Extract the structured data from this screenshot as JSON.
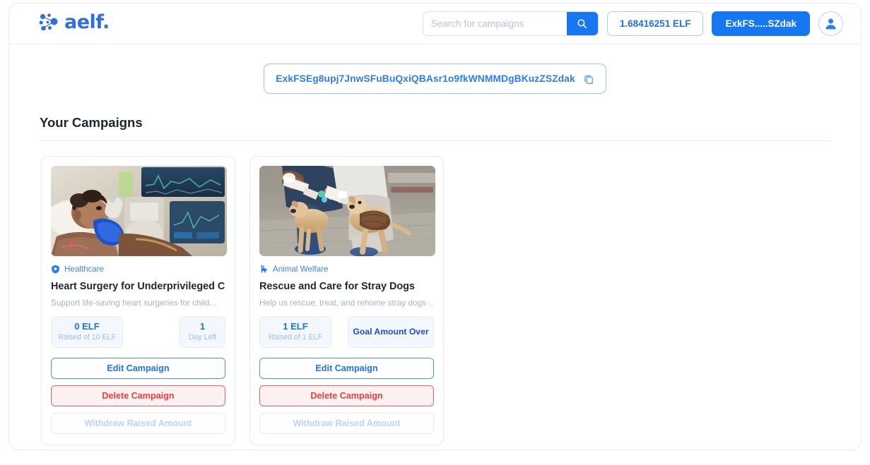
{
  "brand": {
    "name": "aelf.",
    "logo_icon": "aelf-dots-logo"
  },
  "header": {
    "search": {
      "placeholder": "Search for campaigns",
      "value": "",
      "button_icon": "search-icon"
    },
    "balance": "1.68416251 ELF",
    "wallet_button": "ExkFS.....SZdak",
    "avatar_icon": "user-avatar-icon"
  },
  "address_bar": {
    "address": "ExkFSEg8upj7JnwSFuBuQxiQBAsr1o9fkWNMMDgBKuzZSZdak",
    "copy_icon": "copy-icon"
  },
  "main": {
    "section_title": "Your Campaigns"
  },
  "campaigns": [
    {
      "category": "Healthcare",
      "category_icon": "shield-health-icon",
      "title": "Heart Surgery for Underprivileged C...",
      "description": "Support life-saving heart surgeries for child...",
      "raised_amount": "0 ELF",
      "raised_of": "Raised of 10 ELF",
      "meta_primary": "1",
      "meta_secondary": "Day Left",
      "meta_single": "",
      "image_alt": "child-in-hospital-photo",
      "actions": {
        "edit": "Edit Campaign",
        "delete": "Delete Campaign",
        "withdraw": "Withdraw Raised Amount"
      }
    },
    {
      "category": "Animal Welfare",
      "category_icon": "animal-deer-icon",
      "title": "Rescue and Care for Stray Dogs",
      "description": "Help us rescue, treat, and rehome stray dogs ...",
      "raised_amount": "1 ELF",
      "raised_of": "Raised of 1 ELF",
      "meta_primary": "",
      "meta_secondary": "",
      "meta_single": "Goal Amount Over",
      "image_alt": "puppies-being-fed-photo",
      "actions": {
        "edit": "Edit Campaign",
        "delete": "Delete Campaign",
        "withdraw": "Withdraw Raised Amount"
      }
    }
  ],
  "colors": {
    "primary": "#1677f2",
    "primary_text": "#2b7ef0",
    "danger": "#f23b3b",
    "muted": "#a7b1bd"
  }
}
